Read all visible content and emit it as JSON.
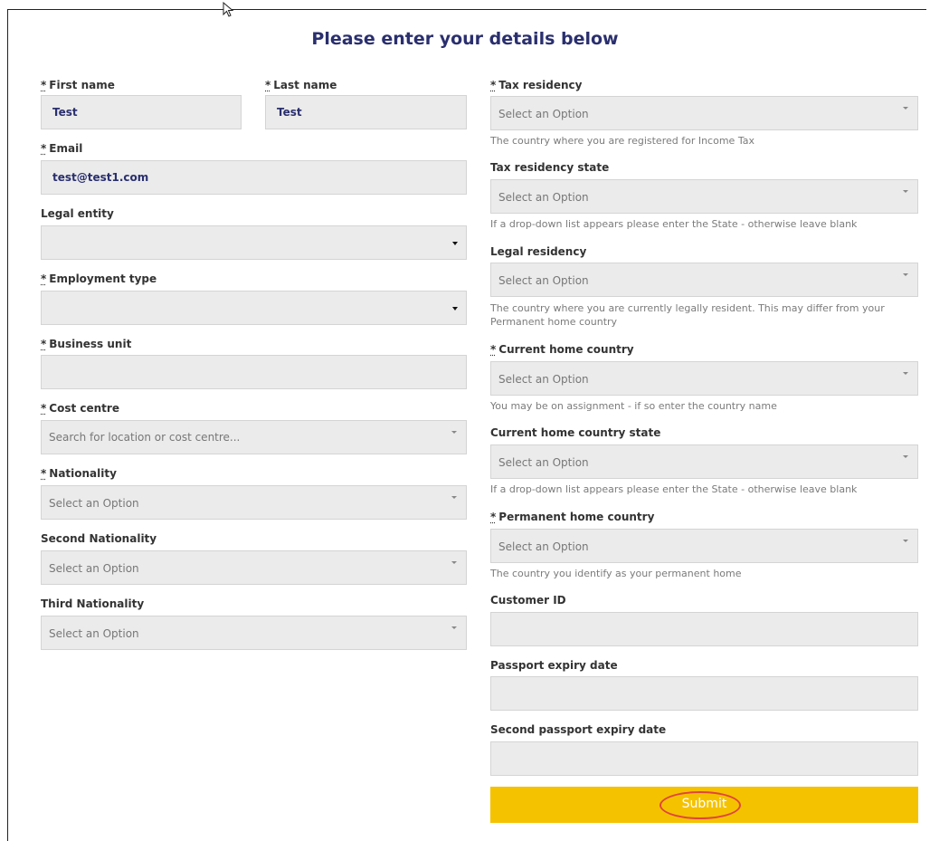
{
  "form": {
    "title": "Please enter your details below",
    "required_mark": "*",
    "first_name": {
      "label": "First name",
      "value": "Test"
    },
    "last_name": {
      "label": "Last name",
      "value": "Test"
    },
    "email": {
      "label": "Email",
      "value": "test@test1.com"
    },
    "legal_entity": {
      "label": "Legal entity",
      "value": ""
    },
    "employment_type": {
      "label": "Employment type",
      "value": ""
    },
    "business_unit": {
      "label": "Business unit",
      "value": ""
    },
    "cost_centre": {
      "label": "Cost centre",
      "placeholder": "Search for location or cost centre..."
    },
    "nationality": {
      "label": "Nationality",
      "placeholder": "Select an Option"
    },
    "second_nationality": {
      "label": "Second Nationality",
      "placeholder": "Select an Option"
    },
    "third_nationality": {
      "label": "Third Nationality",
      "placeholder": "Select an Option"
    },
    "tax_residency": {
      "label": "Tax residency",
      "placeholder": "Select an Option",
      "hint": "The country where you are registered for Income Tax"
    },
    "tax_residency_state": {
      "label": "Tax residency state",
      "placeholder": "Select an Option",
      "hint": "If a drop-down list appears please enter the State - otherwise leave blank"
    },
    "legal_residency": {
      "label": "Legal residency",
      "placeholder": "Select an Option",
      "hint_line1": "The country where you are currently legally resident. This may differ from your",
      "hint_line2": "Permanent home country"
    },
    "current_home_country": {
      "label": "Current home country",
      "placeholder": "Select an Option",
      "hint": "You may be on assignment - if so enter the country name"
    },
    "current_home_country_state": {
      "label": "Current home country state",
      "placeholder": "Select an Option",
      "hint": "If a drop-down list appears please enter the State - otherwise leave blank"
    },
    "permanent_home_country": {
      "label": "Permanent home country",
      "placeholder": "Select an Option",
      "hint": "The country you identify as your permanent home"
    },
    "customer_id": {
      "label": "Customer ID",
      "value": ""
    },
    "passport_expiry": {
      "label": "Passport expiry date",
      "value": ""
    },
    "second_passport_expiry": {
      "label": "Second passport expiry date",
      "value": ""
    },
    "submit_label": "Submit"
  },
  "colors": {
    "title": "#2a2f6e",
    "field_bg": "#ebebeb",
    "submit_bg": "#f5c200",
    "highlight_ring": "#e0453a"
  },
  "icons": {
    "cursor": "mouse-pointer-icon",
    "dropdown": "caret-down-icon"
  }
}
